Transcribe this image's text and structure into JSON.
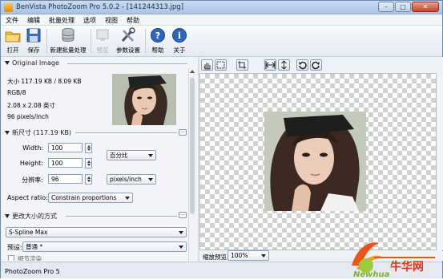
{
  "titlebar": {
    "title": "BenVista PhotoZoom Pro 5.0.2 - [141244313.jpg]",
    "min": "–",
    "max": "□",
    "close": "✕"
  },
  "menu": [
    "文件",
    "编辑",
    "批量处理",
    "选项",
    "视图",
    "帮助"
  ],
  "toolbar": {
    "open": "打开",
    "save": "保存",
    "batch": "新建批量处理",
    "preview": "预览",
    "settings": "参数设置",
    "help": "帮助",
    "about": "关于"
  },
  "original": {
    "header": "Original Image",
    "size": "大小 117.19 KB / 8.09 KB",
    "mode": "RGB/8",
    "dims": "2.08 x 2.08 英寸",
    "res": "96 pixels/inch"
  },
  "newsize": {
    "header": "新尺寸 (117.19 KB)",
    "width_label": "Width:",
    "width": "100",
    "height_label": "Height:",
    "height": "100",
    "res_label": "分辨率:",
    "res": "96",
    "unit": "百分比",
    "res_unit": "pixels/inch",
    "aspect_label": "Aspect ratio:",
    "aspect": "Constrain proportions",
    "more": "..."
  },
  "method": {
    "header": "更改大小的方式",
    "algo": "S-Spline Max",
    "preset_label": "预设:",
    "preset": "普通 *",
    "check": "细节渲染"
  },
  "zoom": {
    "label": "缩放预览:",
    "value": "100%"
  },
  "status": "PhotoZoom Pro 5",
  "watermark": {
    "text": "牛华网",
    "site": "Newhua"
  },
  "colors": {
    "accent": "#2c64b5",
    "titlebar": "#b8cfec"
  }
}
